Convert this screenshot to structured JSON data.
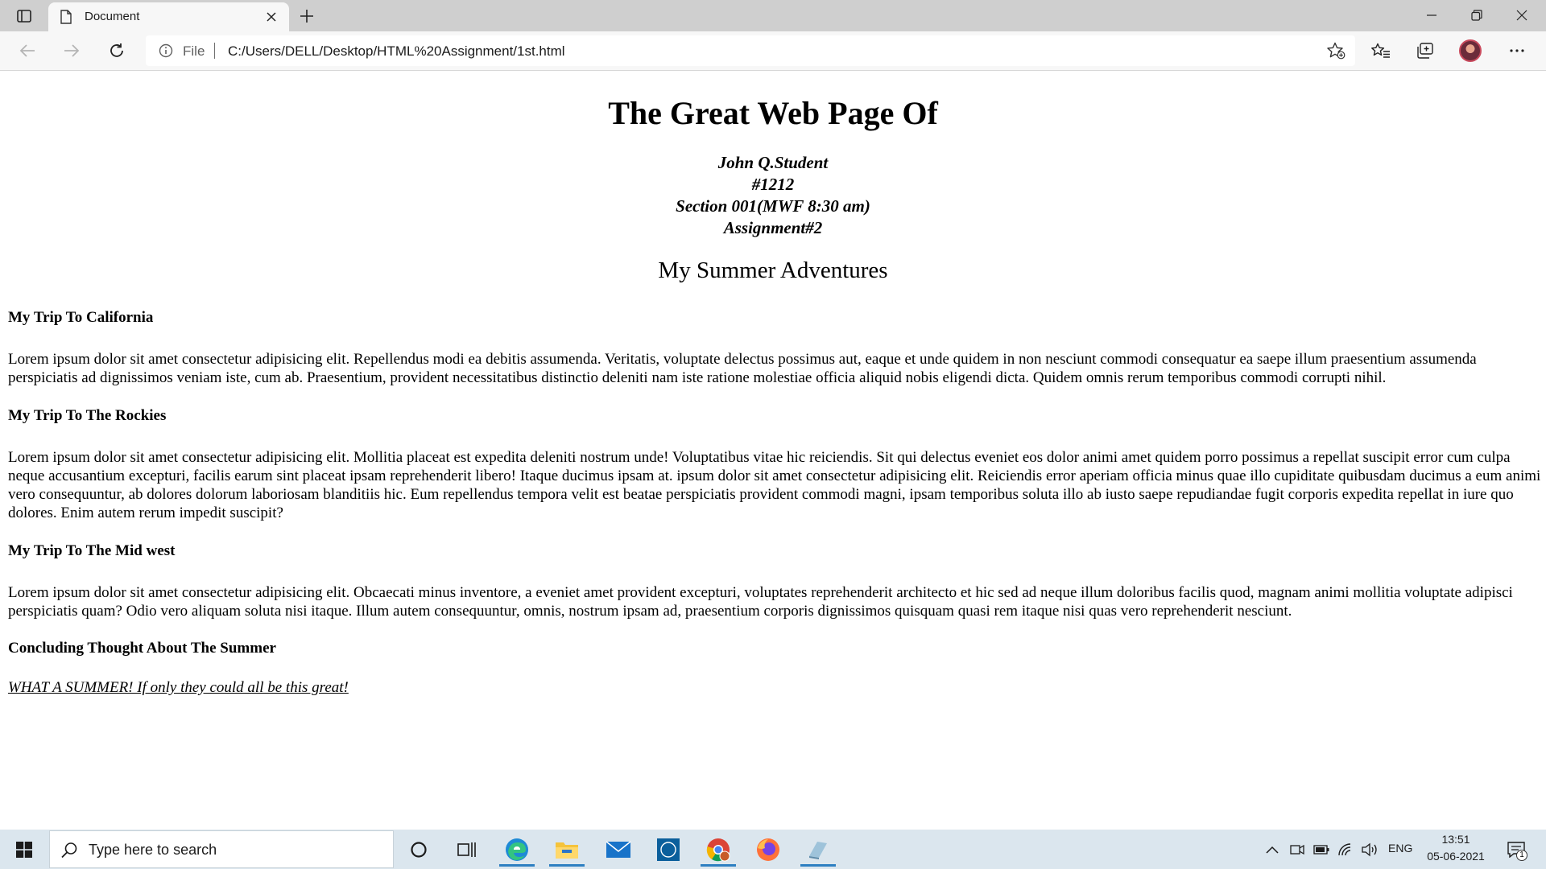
{
  "browser": {
    "tab_title": "Document",
    "address_scheme_label": "File",
    "address_url": "C:/Users/DELL/Desktop/HTML%20Assignment/1st.html"
  },
  "page": {
    "heading": "The Great Web Page Of",
    "author_lines": [
      "John Q.Student",
      "#1212",
      "Section 001(MWF 8:30 am)",
      "Assignment#2"
    ],
    "subtitle": "My Summer Adventures",
    "sections": [
      {
        "title": "My Trip To California",
        "text": "Lorem ipsum dolor sit amet consectetur adipisicing elit. Repellendus modi ea debitis assumenda. Veritatis, voluptate delectus possimus aut, eaque et unde quidem in non nesciunt commodi consequatur ea saepe illum praesentium assumenda perspiciatis ad dignissimos veniam iste, cum ab. Praesentium, provident necessitatibus distinctio deleniti nam iste ratione molestiae officia aliquid nobis eligendi dicta. Quidem omnis rerum temporibus commodi corrupti nihil."
      },
      {
        "title": "My Trip To The Rockies",
        "text": "Lorem ipsum dolor sit amet consectetur adipisicing elit. Mollitia placeat est expedita deleniti nostrum unde! Voluptatibus vitae hic reiciendis. Sit qui delectus eveniet eos dolor animi amet quidem porro possimus a repellat suscipit error cum culpa neque accusantium excepturi, facilis earum sint placeat ipsam reprehenderit libero! Itaque ducimus ipsam at. ipsum dolor sit amet consectetur adipisicing elit. Reiciendis error aperiam officia minus quae illo cupiditate quibusdam ducimus a eum animi vero consequuntur, ab dolores dolorum laboriosam blanditiis hic. Eum repellendus tempora velit est beatae perspiciatis provident commodi magni, ipsam temporibus soluta illo ab iusto saepe repudiandae fugit corporis expedita repellat in iure quo dolores. Enim autem rerum impedit suscipit?"
      },
      {
        "title": "My Trip To The Mid west",
        "text": "Lorem ipsum dolor sit amet consectetur adipisicing elit. Obcaecati minus inventore, a eveniet amet provident excepturi, voluptates reprehenderit architecto et hic sed ad neque illum doloribus facilis quod, magnam animi mollitia voluptate adipisci perspiciatis quam? Odio vero aliquam soluta nisi itaque. Illum autem consequuntur, omnis, nostrum ipsam ad, praesentium corporis dignissimos quisquam quasi rem itaque nisi quas vero reprehenderit nesciunt."
      },
      {
        "title": "Concluding Thought About The Summer",
        "text": ""
      }
    ],
    "closing": "WHAT A SUMMER! If only they could all be this great!"
  },
  "taskbar": {
    "search_placeholder": "Type here to search",
    "language": "ENG",
    "time": "13:51",
    "date": "05-06-2021",
    "notification_count": "1",
    "pinned_apps": [
      "task-view",
      "edge",
      "file-explorer",
      "mail",
      "dell",
      "chrome",
      "firefox",
      "app"
    ]
  },
  "colors": {
    "tab_strip": "#cfcfcf",
    "toolbar": "#f7f7f7",
    "taskbar": "#dbe6ee",
    "accent": "#2d7fc1"
  },
  "icons": [
    "tab-actions-icon",
    "document-icon",
    "close-icon",
    "plus-icon",
    "minimize-icon",
    "restore-icon",
    "back-arrow-icon",
    "forward-arrow-icon",
    "refresh-icon",
    "info-icon",
    "add-favorite-star-icon",
    "favorites-icon",
    "collections-icon",
    "more-icon",
    "windows-logo-icon",
    "search-icon",
    "cortana-icon",
    "task-view-icon",
    "chevron-up-icon",
    "meet-now-icon",
    "battery-icon",
    "wifi-icon",
    "volume-icon",
    "notification-icon"
  ]
}
